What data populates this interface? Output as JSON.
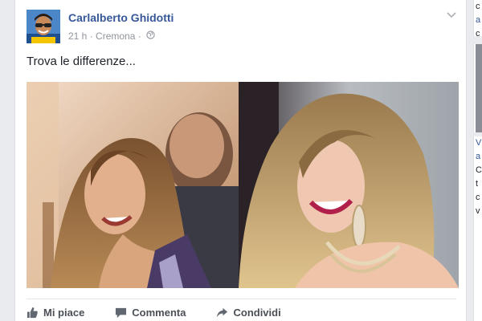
{
  "post": {
    "author": "Carlalberto Ghidotti",
    "time": "21 h",
    "separator": "·",
    "location": "Cremona",
    "text": "Trova le differenze...",
    "icons": {
      "privacy": "globe-icon",
      "menu": "chevron-down-icon"
    }
  },
  "actions": [
    {
      "label": "Mi piace",
      "icon": "thumbs-up-icon"
    },
    {
      "label": "Commenta",
      "icon": "comment-icon"
    },
    {
      "label": "Condividi",
      "icon": "share-icon"
    }
  ],
  "right_rail": {
    "top_letters": [
      "c",
      "a",
      "c"
    ],
    "bottom_letters": [
      "V",
      "a",
      "C",
      "t",
      "c",
      "v"
    ]
  },
  "colors": {
    "link": "#365899",
    "meta": "#90949c",
    "background": "#e9ebee"
  }
}
